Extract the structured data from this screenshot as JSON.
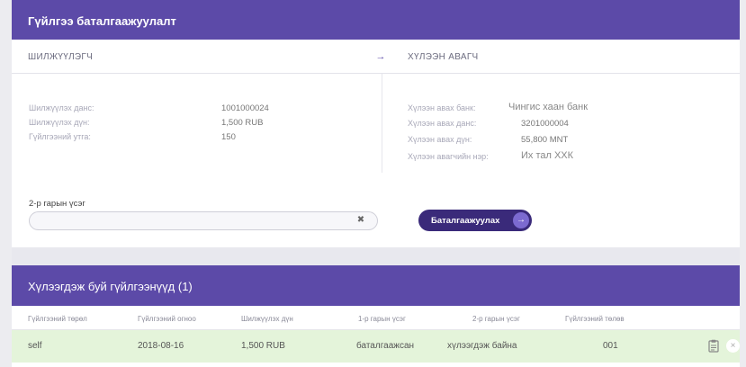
{
  "header": {
    "title": "Гүйлгээ баталгаажуулалт"
  },
  "sender": {
    "heading": "ШИЛЖҮҮЛЭГЧ",
    "fields": [
      {
        "label": "Шилжүүлэх данс:",
        "value": "1001000024"
      },
      {
        "label": "Шилжүүлэх дүн:",
        "value": "1,500 RUB"
      },
      {
        "label": "Гүйлгээний утга:",
        "value": "150"
      }
    ]
  },
  "receiver": {
    "heading": "ХҮЛЭЭН АВАГЧ",
    "fields": [
      {
        "label": "Хүлээн авах банк:",
        "value": "Чингис хаан банк"
      },
      {
        "label": "Хүлээн авах данс:",
        "value": "3201000004"
      },
      {
        "label": "Хүлээн авах дүн:",
        "value": "55,800 MNT"
      },
      {
        "label": "Хүлээн авагчийн нэр:",
        "value": "Их тал ХХК"
      }
    ]
  },
  "pin": {
    "label": "2-р гарын үсэг",
    "value": "",
    "placeholder": ""
  },
  "confirm": {
    "label": "Баталгаажуулах"
  },
  "pending": {
    "title": "Хүлээгдэж буй гүйлгээнүүд (1)",
    "columns": [
      "Гүйлгээний төрөл",
      "Гүйлгээний огноо",
      "Шилжүүлэх дүн",
      "1-р гарын үсэг",
      "2-р гарын үсэг",
      "Гүйлгээний төлөв"
    ],
    "rows": [
      [
        "self",
        "2018-08-16",
        "1,500 RUB",
        "баталгаажсан",
        "хүлээгдэж байна",
        "001"
      ]
    ]
  },
  "colors": {
    "accent": "#5c4aa8",
    "button": "#3a2a7a",
    "row_bg": "#e4f4da"
  },
  "icons": {
    "arrow": "arrow-right-icon",
    "clear": "close-icon",
    "clipboard": "clipboard-icon",
    "remove": "close-icon"
  }
}
